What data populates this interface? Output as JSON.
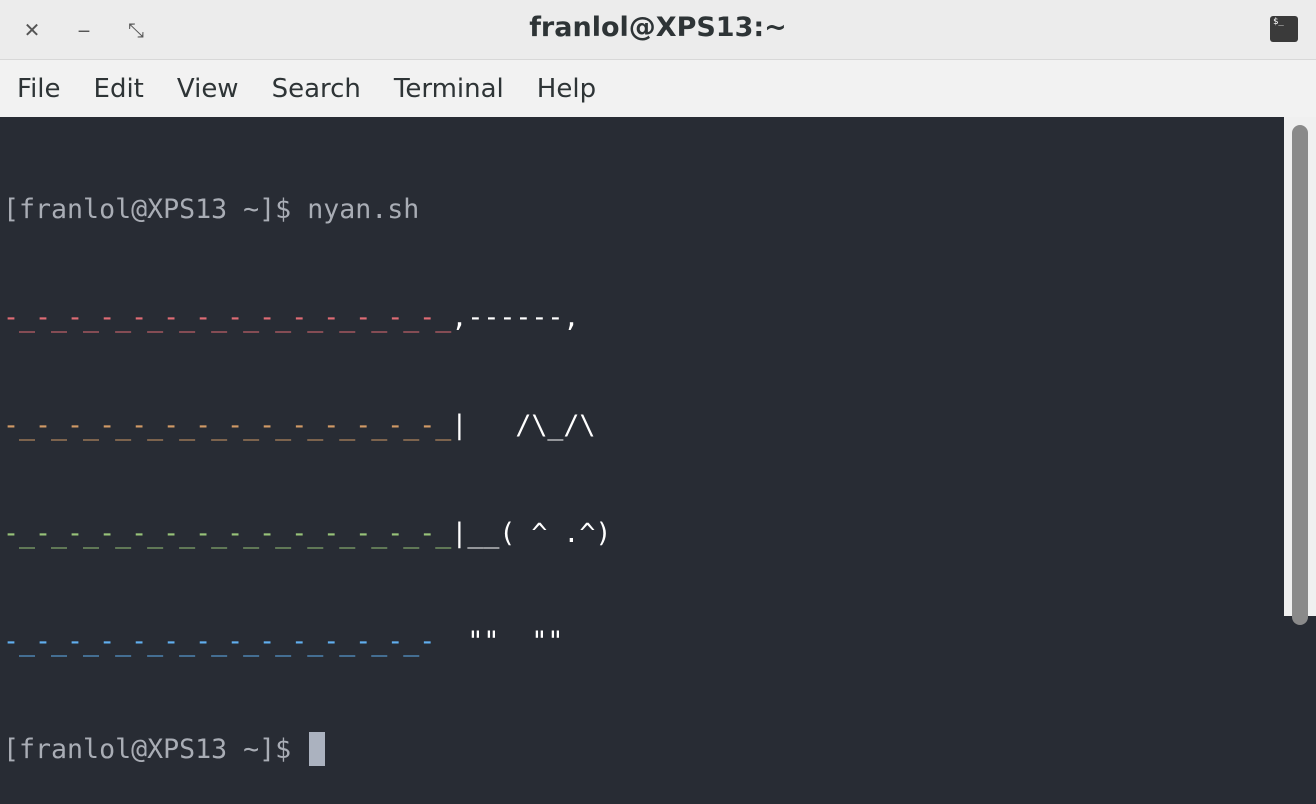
{
  "window": {
    "title": "franlol@XPS13:~",
    "close_glyph": "✕",
    "minimize_glyph": "‒",
    "maximize_glyph": "⤡",
    "app_icon_text": "$_"
  },
  "menu": {
    "items": [
      "File",
      "Edit",
      "View",
      "Search",
      "Terminal",
      "Help"
    ]
  },
  "terminal": {
    "prompt": "[franlol@XPS13 ~]$ ",
    "command": "nyan.sh",
    "art": [
      {
        "trail": "-_-_-_-_-_-_-_-_-_-_-_-_-_-_",
        "cat": ",------,"
      },
      {
        "trail": "-_-_-_-_-_-_-_-_-_-_-_-_-_-_",
        "cat": "|   /\\_/\\"
      },
      {
        "trail": "-_-_-_-_-_-_-_-_-_-_-_-_-_-_",
        "cat": "|__( ^ .^)"
      },
      {
        "trail": "-_-_-_-_-_-_-_-_-_-_-_-_-_- ",
        "cat": " \"\"  \"\""
      }
    ],
    "second_prompt": "[franlol@XPS13 ~]$ "
  },
  "colors": {
    "background": "#282c34",
    "trail_red": "#e06c75",
    "trail_orange": "#d19a66",
    "trail_green": "#98c379",
    "trail_blue": "#61afef"
  }
}
